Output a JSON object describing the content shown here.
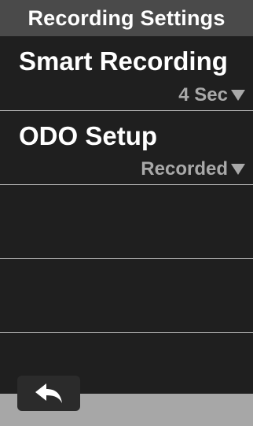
{
  "header": {
    "title": "Recording Settings"
  },
  "settings": {
    "items": [
      {
        "label": "Smart Recording",
        "value": "4 Sec"
      },
      {
        "label": "ODO Setup",
        "value": "Recorded"
      }
    ]
  },
  "footer": {
    "back_icon": "back-arrow-icon"
  },
  "colors": {
    "background": "#1f1f1f",
    "header": "#4a4a4a",
    "text": "#ffffff",
    "value_text": "#a9a9a9",
    "divider": "#bdbdbd",
    "footer": "#a7a7a7",
    "button": "#2b2b2b"
  }
}
